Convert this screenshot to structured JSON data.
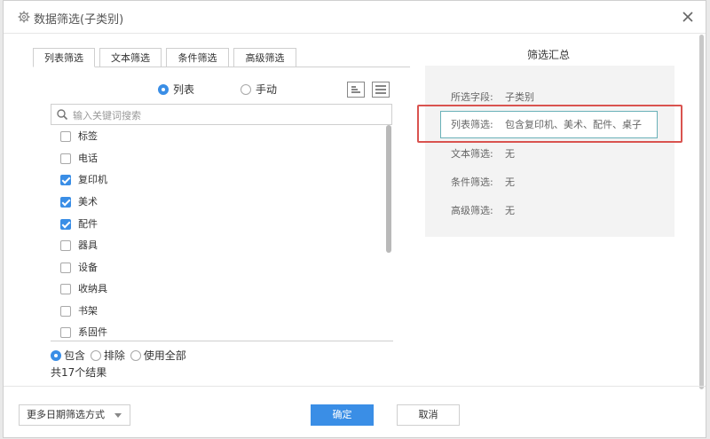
{
  "dialog": {
    "title": "数据筛选(子类别)",
    "close_label": "关闭"
  },
  "tabs": [
    "列表筛选",
    "文本筛选",
    "条件筛选",
    "高级筛选"
  ],
  "mode": {
    "options": [
      "列表",
      "手动"
    ],
    "selected": "列表"
  },
  "icons": [
    "gear-icon",
    "close-icon",
    "sort-icon",
    "menu-icon",
    "search-icon",
    "chevron-down-icon"
  ],
  "search": {
    "placeholder": "输入关键词搜索",
    "value": ""
  },
  "list": {
    "items": [
      {
        "label": "标签",
        "checked": false
      },
      {
        "label": "电话",
        "checked": false
      },
      {
        "label": "复印机",
        "checked": true
      },
      {
        "label": "美术",
        "checked": true
      },
      {
        "label": "配件",
        "checked": true
      },
      {
        "label": "器具",
        "checked": false
      },
      {
        "label": "设备",
        "checked": false
      },
      {
        "label": "收纳具",
        "checked": false
      },
      {
        "label": "书架",
        "checked": false
      },
      {
        "label": "系固件",
        "checked": false
      }
    ]
  },
  "include": {
    "options": [
      "包含",
      "排除",
      "使用全部"
    ],
    "selected": "包含"
  },
  "result_text": "共17个结果",
  "summary": {
    "title": "筛选汇总",
    "rows": [
      {
        "key": "所选字段:",
        "value": "子类别"
      },
      {
        "key": "列表筛选:",
        "value": "包含复印机、美术、配件、桌子"
      },
      {
        "key": "文本筛选:",
        "value": "无"
      },
      {
        "key": "条件筛选:",
        "value": "无"
      },
      {
        "key": "高级筛选:",
        "value": "无"
      }
    ]
  },
  "footer": {
    "date_dropdown": "更多日期筛选方式",
    "ok": "确定",
    "cancel": "取消"
  },
  "colors": {
    "accent": "#3a8ee6",
    "highlight_border": "#d9534f"
  }
}
